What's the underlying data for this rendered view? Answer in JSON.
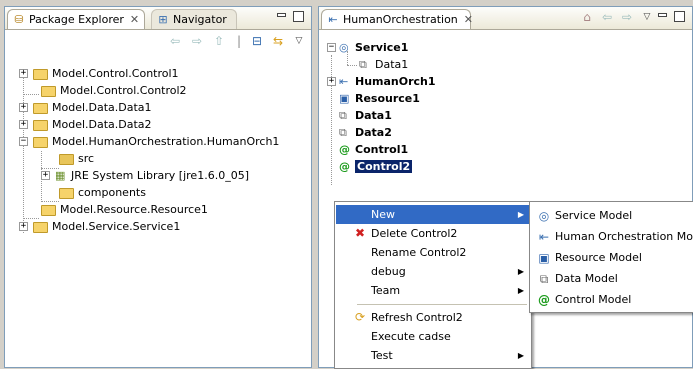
{
  "left_panel": {
    "tabs": [
      {
        "label": "Package Explorer",
        "close": "✕",
        "icon": "package-explorer-icon"
      },
      {
        "label": "Navigator",
        "icon": "navigator-icon"
      }
    ],
    "tree": [
      {
        "label": "Model.Control.Control1",
        "expand": "+"
      },
      {
        "label": "Model.Control.Control2",
        "expand": ""
      },
      {
        "label": "Model.Data.Data1",
        "expand": "+"
      },
      {
        "label": "Model.Data.Data2",
        "expand": "+"
      },
      {
        "label": "Model.HumanOrchestration.HumanOrch1",
        "expand": "−"
      },
      {
        "label": "src",
        "expand": ""
      },
      {
        "label": "JRE System Library [jre1.6.0_05]",
        "expand": "+"
      },
      {
        "label": "components",
        "expand": ""
      },
      {
        "label": "Model.Resource.Resource1",
        "expand": ""
      },
      {
        "label": "Model.Service.Service1",
        "expand": "+"
      }
    ]
  },
  "right_panel": {
    "tab": {
      "label": "HumanOrchestration",
      "close": "✕",
      "icon": "human-orchestration-icon"
    },
    "tree": [
      {
        "label": "Service1",
        "expand": "−",
        "icon": "service-icon"
      },
      {
        "label": "Data1",
        "expand": "",
        "icon": "data-icon"
      },
      {
        "label": "HumanOrch1",
        "expand": "+",
        "icon": "human-orch-icon"
      },
      {
        "label": "Resource1",
        "expand": "",
        "icon": "resource-icon"
      },
      {
        "label": "Data1",
        "expand": "",
        "icon": "data-icon"
      },
      {
        "label": "Data2",
        "expand": "",
        "icon": "data-icon"
      },
      {
        "label": "Control1",
        "expand": "",
        "icon": "control-icon"
      },
      {
        "label": "Control2",
        "expand": "",
        "icon": "control-icon"
      }
    ]
  },
  "context_menu": {
    "items": [
      {
        "label": "New",
        "submenu": true,
        "highlighted": true
      },
      {
        "label": "Delete Control2",
        "icon": "delete-icon"
      },
      {
        "label": "Rename Control2"
      },
      {
        "label": "debug",
        "submenu": true
      },
      {
        "label": "Team",
        "submenu": true
      },
      {
        "label": "Refresh Control2",
        "icon": "refresh-icon"
      },
      {
        "label": "Execute cadse"
      },
      {
        "label": "Test",
        "submenu": true
      }
    ]
  },
  "new_submenu": {
    "items": [
      {
        "label": "Service Model",
        "icon": "service-icon"
      },
      {
        "label": "Human Orchestration Model",
        "icon": "human-orch-icon"
      },
      {
        "label": "Resource Model",
        "icon": "resource-icon"
      },
      {
        "label": "Data Model",
        "icon": "data-icon"
      },
      {
        "label": "Control Model",
        "icon": "control-icon"
      }
    ]
  },
  "colors": {
    "selection": "#0a246a",
    "menu_highlight": "#316ac5",
    "folder": "#f6d36a"
  }
}
